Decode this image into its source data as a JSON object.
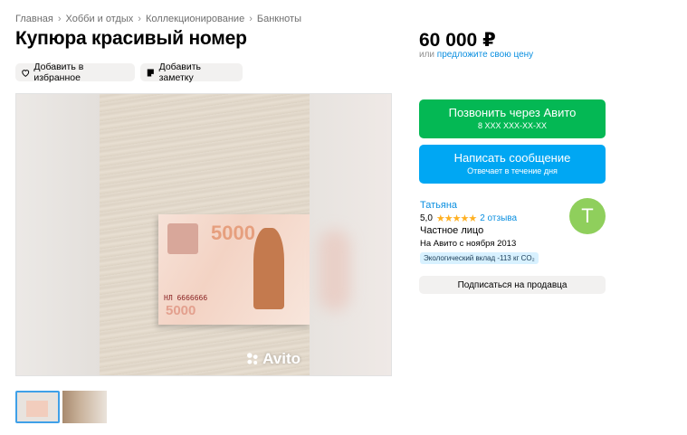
{
  "breadcrumb": [
    "Главная",
    "Хобби и отдых",
    "Коллекционирование",
    "Банкноты"
  ],
  "title": "Купюра красивый номер",
  "actions": {
    "favorite": "Добавить в избранное",
    "note": "Добавить заметку"
  },
  "gallery": {
    "watermark": "Avito",
    "banknote": {
      "denomination": "5000",
      "serial": "НЛ 6666666"
    }
  },
  "price": {
    "value": "60 000 ₽",
    "prefix": "или",
    "offer_link": "предложите свою цену"
  },
  "call_button": {
    "label": "Позвонить через Авито",
    "phone": "8 XXX XXX-XX-XX"
  },
  "message_button": {
    "label": "Написать сообщение",
    "sub": "Отвечает в течение дня"
  },
  "seller": {
    "name": "Татьяна",
    "rating": "5,0",
    "stars": "★★★★★",
    "reviews": "2 отзыва",
    "type": "Частное лицо",
    "since": "На Авито с ноября 2013",
    "eco": "Экологический вклад -113 кг CO₂",
    "avatar_letter": "Т",
    "avatar_color": "#8fcf5c"
  },
  "subscribe": "Подписаться на продавца"
}
